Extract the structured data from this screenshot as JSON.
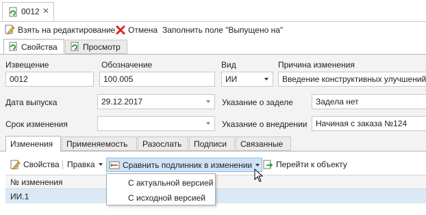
{
  "document_tab": {
    "title": "0012",
    "close_glyph": "✕",
    "icon": "document-refresh-icon"
  },
  "toolbar": {
    "take_for_edit": "Взять на редактирование",
    "cancel": "Отмена",
    "fill_released": "Заполнить поле \"Выпущено на\""
  },
  "tabs": {
    "properties": "Свойства",
    "preview": "Просмотр"
  },
  "form": {
    "notice_label": "Извещение",
    "notice_value": "0012",
    "designation_label": "Обозначение",
    "designation_value": "100.005",
    "type_label": "Вид",
    "type_value": "ИИ",
    "reason_label": "Причина изменения",
    "reason_value": "Введение конструктивных улучшений",
    "release_date_label": "Дата выпуска",
    "release_date_value": "29.12.2017",
    "backlog_label": "Указание о заделе",
    "backlog_value": "Задела нет",
    "change_term_label": "Срок изменения",
    "change_term_value": "",
    "implementation_label": "Указание о внедрении",
    "implementation_value": "Начиная с заказа №124"
  },
  "bottom_tabs": [
    "Изменения",
    "Применяемость",
    "Разослать",
    "Подписи",
    "Связанные"
  ],
  "bottom_toolbar": {
    "properties": "Свойства",
    "edit": "Правка",
    "compare": "Сравнить подлинник в изменении",
    "goto": "Перейти к объекту"
  },
  "grid": {
    "header": "№ изменения",
    "rows": [
      "ИИ.1"
    ]
  },
  "compare_menu": {
    "items": [
      "С актуальной версией",
      "С исходной версией"
    ]
  },
  "colors": {
    "accent_green": "#2e9b3c",
    "cancel_red": "#d9261c",
    "selection_blue": "#dbe9f7",
    "hover_blue": "#cfe2f6"
  }
}
